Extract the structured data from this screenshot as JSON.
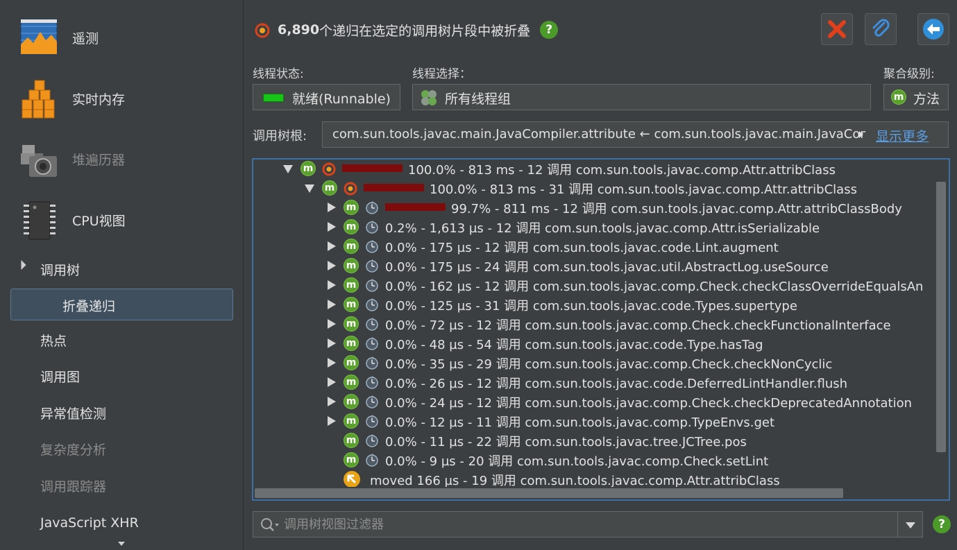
{
  "sidebar": {
    "big_items": [
      {
        "label": "遥测",
        "icon": "telemetry-chart-icon",
        "enabled": true
      },
      {
        "label": "实时内存",
        "icon": "memory-cubes-icon",
        "enabled": true
      },
      {
        "label": "堆遍历器",
        "icon": "camera-icon",
        "enabled": false
      },
      {
        "label": "CPU视图",
        "icon": "cpu-chip-icon",
        "enabled": true
      }
    ],
    "section": {
      "label": "调用树",
      "expanded": true
    },
    "selected_item": "折叠递归",
    "sub_items": [
      {
        "label": "热点",
        "enabled": true
      },
      {
        "label": "调用图",
        "enabled": true
      },
      {
        "label": "异常值检测",
        "enabled": true
      },
      {
        "label": "复杂度分析",
        "enabled": false
      },
      {
        "label": "调用跟踪器",
        "enabled": false
      },
      {
        "label": "JavaScript XHR",
        "enabled": true
      }
    ]
  },
  "header": {
    "count": "6,890",
    "message": "个递归在选定的调用树片段中被折叠",
    "help_icon": "?"
  },
  "toolbar": {
    "buttons": [
      {
        "name": "close-button",
        "icon": "red-x-icon"
      },
      {
        "name": "attach-button",
        "icon": "paperclip-icon"
      },
      {
        "name": "back-button",
        "icon": "back-arrow-icon"
      }
    ]
  },
  "filters": {
    "thread_state_label": "线程状态:",
    "thread_state_value": "就绪(Runnable)",
    "thread_select_label": "线程选择：",
    "thread_select_value": "所有线程组",
    "aggregation_label": "聚合级别:",
    "aggregation_value": "方法"
  },
  "root": {
    "label": "调用树根:",
    "value": "com.sun.tools.javac.main.JavaCompiler.attribute ← com.sun.tools.javac.main.JavaCompiler.",
    "more": "显示更多"
  },
  "tree": {
    "rows": [
      {
        "depth": 0,
        "toggle": "expanded",
        "icon": "m",
        "time_icon": "recursion",
        "bar_pct": 100.0,
        "text": "100.0% - 813 ms - 12 调用 com.sun.tools.javac.comp.Attr.attribClass"
      },
      {
        "depth": 1,
        "toggle": "expanded",
        "icon": "m",
        "time_icon": "recursion",
        "bar_pct": 100.0,
        "text": "100.0% - 813 ms - 31 调用 com.sun.tools.javac.comp.Attr.attribClass"
      },
      {
        "depth": 2,
        "toggle": "collapsed",
        "icon": "m",
        "time_icon": "clock",
        "bar_pct": 99.7,
        "text": "99.7% - 811 ms - 12 调用 com.sun.tools.javac.comp.Attr.attribClassBody"
      },
      {
        "depth": 2,
        "toggle": "collapsed",
        "icon": "m",
        "time_icon": "clock",
        "bar_pct": 0.2,
        "text": "0.2% - 1,613 µs - 12 调用 com.sun.tools.javac.comp.Attr.isSerializable"
      },
      {
        "depth": 2,
        "toggle": "collapsed",
        "icon": "m",
        "time_icon": "clock",
        "bar_pct": 0.0,
        "text": "0.0% - 175 µs - 12 调用 com.sun.tools.javac.code.Lint.augment"
      },
      {
        "depth": 2,
        "toggle": "collapsed",
        "icon": "m",
        "time_icon": "clock",
        "bar_pct": 0.0,
        "text": "0.0% - 175 µs - 24 调用 com.sun.tools.javac.util.AbstractLog.useSource"
      },
      {
        "depth": 2,
        "toggle": "collapsed",
        "icon": "m",
        "time_icon": "clock",
        "bar_pct": 0.0,
        "text": "0.0% - 162 µs - 12 调用 com.sun.tools.javac.comp.Check.checkClassOverrideEqualsAn"
      },
      {
        "depth": 2,
        "toggle": "collapsed",
        "icon": "m",
        "time_icon": "clock",
        "bar_pct": 0.0,
        "text": "0.0% - 125 µs - 31 调用 com.sun.tools.javac.code.Types.supertype"
      },
      {
        "depth": 2,
        "toggle": "collapsed",
        "icon": "m",
        "time_icon": "clock",
        "bar_pct": 0.0,
        "text": "0.0% - 72 µs - 12 调用 com.sun.tools.javac.comp.Check.checkFunctionalInterface"
      },
      {
        "depth": 2,
        "toggle": "collapsed",
        "icon": "m",
        "time_icon": "clock",
        "bar_pct": 0.0,
        "text": "0.0% - 48 µs - 54 调用 com.sun.tools.javac.code.Type.hasTag"
      },
      {
        "depth": 2,
        "toggle": "collapsed",
        "icon": "m",
        "time_icon": "clock",
        "bar_pct": 0.0,
        "text": "0.0% - 35 µs - 29 调用 com.sun.tools.javac.comp.Check.checkNonCyclic"
      },
      {
        "depth": 2,
        "toggle": "collapsed",
        "icon": "m",
        "time_icon": "clock",
        "bar_pct": 0.0,
        "text": "0.0% - 26 µs - 12 调用 com.sun.tools.javac.code.DeferredLintHandler.flush"
      },
      {
        "depth": 2,
        "toggle": "collapsed",
        "icon": "m",
        "time_icon": "clock",
        "bar_pct": 0.0,
        "text": "0.0% - 24 µs - 12 调用 com.sun.tools.javac.comp.Check.checkDeprecatedAnnotation"
      },
      {
        "depth": 2,
        "toggle": "collapsed",
        "icon": "m",
        "time_icon": "clock",
        "bar_pct": 0.0,
        "text": "0.0% - 12 µs - 11 调用 com.sun.tools.javac.comp.TypeEnvs.get"
      },
      {
        "depth": 2,
        "toggle": "none",
        "icon": "m",
        "time_icon": "clock",
        "bar_pct": 0.0,
        "text": "0.0% - 11 µs - 22 调用 com.sun.tools.javac.tree.JCTree.pos"
      },
      {
        "depth": 2,
        "toggle": "none",
        "icon": "m",
        "time_icon": "clock",
        "bar_pct": 0.0,
        "text": "0.0% - 9 µs - 20 调用 com.sun.tools.javac.comp.Check.setLint"
      },
      {
        "depth": 2,
        "toggle": "none",
        "icon": "moved",
        "time_icon": "none",
        "bar_pct": 0.0,
        "text": "moved 166 µs - 19 调用  com.sun.tools.javac.comp.Attr.attribClass"
      }
    ]
  },
  "filter": {
    "placeholder": "调用树视图过滤器",
    "help_icon": "?"
  },
  "colors": {
    "bar": "#7d0b0b",
    "selection_border": "#3e6fa6",
    "method_icon": "#5aa02c",
    "link": "#5a9ee6"
  }
}
